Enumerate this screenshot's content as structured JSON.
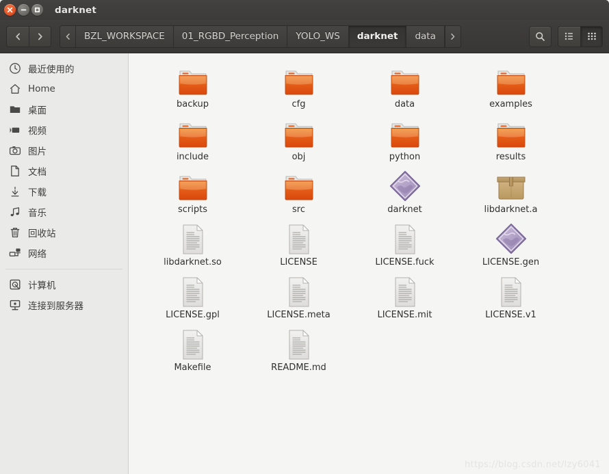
{
  "window": {
    "title": "darknet",
    "controls": [
      {
        "name": "close",
        "glyph": "×"
      },
      {
        "name": "minimize",
        "glyph": "−"
      },
      {
        "name": "maximize",
        "glyph": "□"
      }
    ]
  },
  "toolbar": {
    "back_icon": "chevron-left-icon",
    "forward_icon": "chevron-right-icon",
    "breadcrumb_prev_icon": "chevron-left-icon",
    "breadcrumb_next_icon": "chevron-right-icon",
    "search_icon": "search-icon",
    "list_view_icon": "list-view-icon",
    "grid_view_icon": "grid-view-icon",
    "active_view": "grid",
    "breadcrumbs": [
      {
        "label": "BZL_WORKSPACE",
        "active": false
      },
      {
        "label": "01_RGBD_Perception",
        "active": false
      },
      {
        "label": "YOLO_WS",
        "active": false
      },
      {
        "label": "darknet",
        "active": true
      },
      {
        "label": "data",
        "active": false
      }
    ]
  },
  "sidebar": {
    "groups": [
      {
        "items": [
          {
            "label": "最近使用的",
            "icon": "clock-icon"
          },
          {
            "label": "Home",
            "icon": "home-icon"
          },
          {
            "label": "桌面",
            "icon": "folder-icon"
          },
          {
            "label": "视频",
            "icon": "video-icon"
          },
          {
            "label": "图片",
            "icon": "camera-icon"
          },
          {
            "label": "文档",
            "icon": "document-icon"
          },
          {
            "label": "下载",
            "icon": "download-icon"
          },
          {
            "label": "音乐",
            "icon": "music-icon"
          },
          {
            "label": "回收站",
            "icon": "trash-icon"
          },
          {
            "label": "网络",
            "icon": "network-icon"
          }
        ]
      },
      {
        "items": [
          {
            "label": "计算机",
            "icon": "computer-disk-icon"
          },
          {
            "label": "连接到服务器",
            "icon": "server-connect-icon"
          }
        ]
      }
    ]
  },
  "files": [
    {
      "name": "backup",
      "type": "folder"
    },
    {
      "name": "cfg",
      "type": "folder"
    },
    {
      "name": "data",
      "type": "folder"
    },
    {
      "name": "examples",
      "type": "folder"
    },
    {
      "name": "include",
      "type": "folder"
    },
    {
      "name": "obj",
      "type": "folder"
    },
    {
      "name": "python",
      "type": "folder"
    },
    {
      "name": "results",
      "type": "folder"
    },
    {
      "name": "scripts",
      "type": "folder"
    },
    {
      "name": "src",
      "type": "folder"
    },
    {
      "name": "darknet",
      "type": "executable"
    },
    {
      "name": "libdarknet.a",
      "type": "archive"
    },
    {
      "name": "libdarknet.so",
      "type": "document"
    },
    {
      "name": "LICENSE",
      "type": "document"
    },
    {
      "name": "LICENSE.fuck",
      "type": "document"
    },
    {
      "name": "LICENSE.gen",
      "type": "executable"
    },
    {
      "name": "LICENSE.gpl",
      "type": "document"
    },
    {
      "name": "LICENSE.meta",
      "type": "document"
    },
    {
      "name": "LICENSE.mit",
      "type": "document"
    },
    {
      "name": "LICENSE.v1",
      "type": "document"
    },
    {
      "name": "Makefile",
      "type": "document"
    },
    {
      "name": "README.md",
      "type": "document"
    }
  ],
  "watermark": {
    "text": "https://blog.csdn.net/lzy6041"
  },
  "colors": {
    "titlebar": "#3f3e3c",
    "toolbar": "#3a3937",
    "sidebar": "#eaeae8",
    "content": "#f5f5f4",
    "folder_orange": "#e9601f",
    "executable_purple": "#9b87b5",
    "archive_tan": "#c7a878",
    "close_button": "#e2562a"
  }
}
